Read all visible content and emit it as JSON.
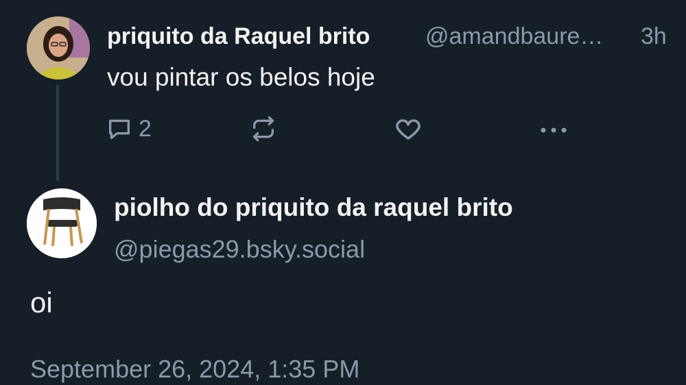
{
  "parent_post": {
    "display_name": "priquito da Raquel brito",
    "handle": "@amandbaure…",
    "time_ago": "3h",
    "text": "vou pintar os belos hoje",
    "reply_count": "2"
  },
  "icons": {
    "reply": "comment-bubble-icon",
    "repost": "repost-icon",
    "like": "heart-icon",
    "more": "more-dots-icon"
  },
  "reply_post": {
    "display_name": "piolho do priquito da raquel brito",
    "handle": "@piegas29.bsky.social",
    "text": "oi",
    "timestamp": "September 26, 2024, 1:35 PM"
  },
  "colors": {
    "background": "#161e27",
    "primary_text": "#f1f3f5",
    "secondary_text": "#8d99a8",
    "thread_line": "#2e3b4c"
  }
}
